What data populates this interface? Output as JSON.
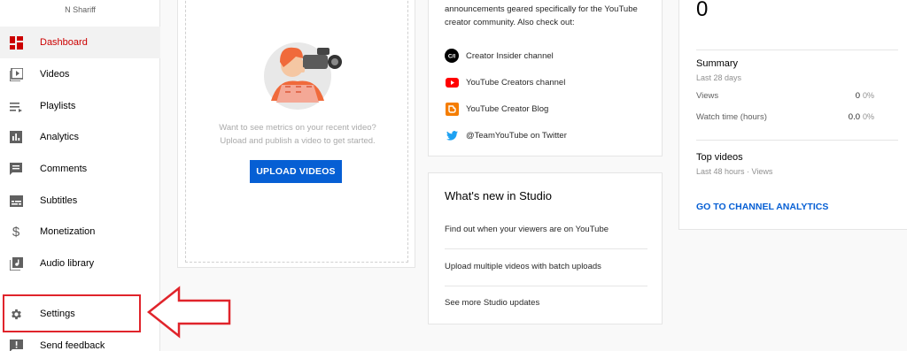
{
  "sidebar": {
    "channel_name": "N Shariff",
    "items": [
      {
        "label": "Dashboard",
        "icon": "dashboard-icon",
        "active": true
      },
      {
        "label": "Videos",
        "icon": "videos-icon"
      },
      {
        "label": "Playlists",
        "icon": "playlists-icon"
      },
      {
        "label": "Analytics",
        "icon": "analytics-icon"
      },
      {
        "label": "Comments",
        "icon": "comments-icon"
      },
      {
        "label": "Subtitles",
        "icon": "subtitles-icon"
      },
      {
        "label": "Monetization",
        "icon": "dollar-icon"
      },
      {
        "label": "Audio library",
        "icon": "audio-library-icon"
      },
      {
        "label": "Settings",
        "icon": "gear-icon"
      },
      {
        "label": "Send feedback",
        "icon": "feedback-icon"
      }
    ]
  },
  "upload": {
    "message_line1": "Want to see metrics on your recent video?",
    "message_line2": "Upload and publish a video to get started.",
    "button_label": "UPLOAD VIDEOS"
  },
  "news": {
    "text_line1": "announcements geared specifically for the YouTube",
    "text_line2": "creator community. Also check out:",
    "links": [
      {
        "label": "Creator Insider channel",
        "icon": "creator-insider-icon"
      },
      {
        "label": "YouTube Creators channel",
        "icon": "youtube-icon"
      },
      {
        "label": "YouTube Creator Blog",
        "icon": "blogger-icon"
      },
      {
        "label": "@TeamYouTube on Twitter",
        "icon": "twitter-icon"
      }
    ]
  },
  "studio": {
    "title": "What's new in Studio",
    "items": [
      "Find out when your viewers are on YouTube",
      "Upload multiple videos with batch uploads",
      "See more Studio updates"
    ]
  },
  "analytics": {
    "subscribers": "0",
    "summary_title": "Summary",
    "summary_period": "Last 28 days",
    "metrics": [
      {
        "label": "Views",
        "value": "0",
        "pct": "0%"
      },
      {
        "label": "Watch time (hours)",
        "value": "0.0",
        "pct": "0%"
      }
    ],
    "top_videos_title": "Top videos",
    "top_videos_sub": "Last 48 hours · Views",
    "link_label": "GO TO CHANNEL ANALYTICS"
  },
  "colors": {
    "accent_red": "#cc0000",
    "link_blue": "#065fd4",
    "annotation_red": "#e0242b"
  }
}
